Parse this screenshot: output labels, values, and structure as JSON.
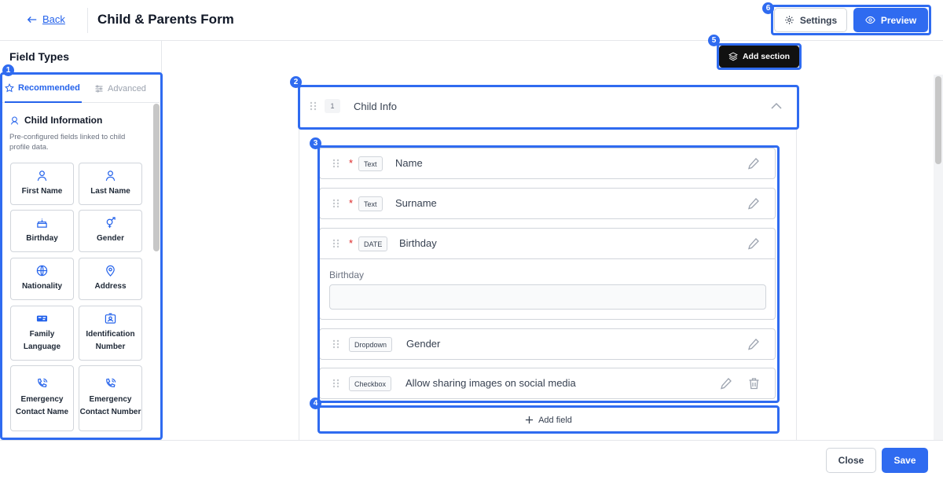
{
  "header": {
    "back_label": "Back",
    "title": "Child & Parents Form",
    "settings_label": "Settings",
    "preview_label": "Preview"
  },
  "sidebar": {
    "title": "Field Types",
    "tabs": [
      {
        "label": "Recommended",
        "active": true,
        "icon": "star-icon"
      },
      {
        "label": "Advanced",
        "active": false,
        "icon": "sliders-icon"
      }
    ],
    "section": {
      "title": "Child Information",
      "icon": "child-icon",
      "description": "Pre-configured fields linked to child profile data."
    },
    "cards": [
      {
        "label": "First Name",
        "icon": "person-icon"
      },
      {
        "label": "Last Name",
        "icon": "person-icon"
      },
      {
        "label": "Birthday",
        "icon": "cake-icon"
      },
      {
        "label": "Gender",
        "icon": "gender-icon"
      },
      {
        "label": "Nationality",
        "icon": "globe-icon"
      },
      {
        "label": "Address",
        "icon": "map-pin-icon"
      },
      {
        "label": "Family Language",
        "icon": "language-icon"
      },
      {
        "label": "Identification Number",
        "icon": "id-card-icon"
      },
      {
        "label": "Emergency Contact Name",
        "icon": "phone-icon"
      },
      {
        "label": "Emergency Contact Number",
        "icon": "phone-icon"
      }
    ]
  },
  "canvas": {
    "add_section_label": "Add section",
    "section": {
      "number": "1",
      "title": "Child Info",
      "fields": [
        {
          "type": "Text",
          "name": "Name",
          "required": true
        },
        {
          "type": "Text",
          "name": "Surname",
          "required": true
        },
        {
          "type": "DATE",
          "name": "Birthday",
          "required": true,
          "expanded": true,
          "preview_label": "Birthday"
        },
        {
          "type": "Dropdown",
          "name": "Gender",
          "required": false
        },
        {
          "type": "Checkbox",
          "name": "Allow sharing images on social media",
          "required": false
        }
      ],
      "required_marker": "*",
      "add_field_label": "Add field"
    }
  },
  "annotations": [
    "1",
    "2",
    "3",
    "4",
    "5",
    "6"
  ],
  "footer": {
    "close_label": "Close",
    "save_label": "Save"
  },
  "colors": {
    "accent": "#2f6bf0",
    "required": "#dc2626",
    "dark_button": "#111111"
  }
}
